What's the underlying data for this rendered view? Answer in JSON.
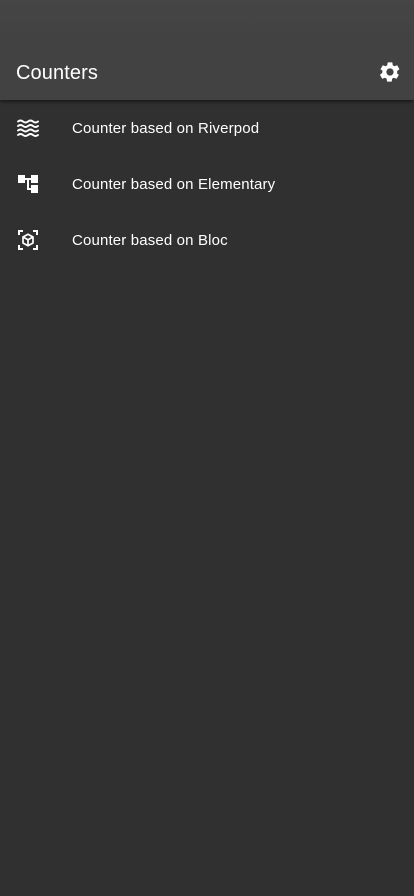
{
  "app_bar": {
    "title": "Counters",
    "settings_icon": "settings-gear-icon"
  },
  "counters": [
    {
      "label": "Counter based on Riverpod",
      "icon": "waves-icon"
    },
    {
      "label": "Counter based on Elementary",
      "icon": "account-tree-icon"
    },
    {
      "label": "Counter based on Bloc",
      "icon": "view-in-ar-icon"
    }
  ],
  "colors": {
    "app_bar": "#424242",
    "background": "#303030",
    "text": "#ffffff"
  }
}
